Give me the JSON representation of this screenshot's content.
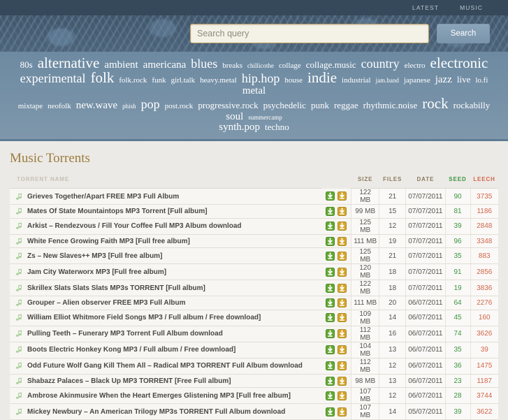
{
  "topnav": {
    "links": [
      {
        "label": "LATEST"
      },
      {
        "label": "MUSIC"
      }
    ]
  },
  "search": {
    "placeholder": "Search query",
    "value": "",
    "button_label": "Search"
  },
  "tagcloud": {
    "rows": [
      [
        {
          "label": "80s",
          "size": "s3"
        },
        {
          "label": "alternative",
          "size": "s6"
        },
        {
          "label": "ambient",
          "size": "s4"
        },
        {
          "label": "americana",
          "size": "s4"
        },
        {
          "label": "blues",
          "size": "s5"
        },
        {
          "label": "breaks",
          "size": "s2"
        },
        {
          "label": "chillicothe",
          "size": "s1"
        },
        {
          "label": "collage",
          "size": "s2"
        },
        {
          "label": "collage.music",
          "size": "s3"
        },
        {
          "label": "country",
          "size": "s5"
        },
        {
          "label": "electro",
          "size": "s2"
        },
        {
          "label": "electronic",
          "size": "s6"
        }
      ],
      [
        {
          "label": "experimental",
          "size": "s5"
        },
        {
          "label": "folk",
          "size": "s6"
        },
        {
          "label": "folk.rock",
          "size": "s2"
        },
        {
          "label": "funk",
          "size": "s2"
        },
        {
          "label": "girl.talk",
          "size": "s2"
        },
        {
          "label": "heavy.metal",
          "size": "s2"
        },
        {
          "label": "hip.hop",
          "size": "s5"
        },
        {
          "label": "house",
          "size": "s2"
        },
        {
          "label": "indie",
          "size": "s6"
        },
        {
          "label": "industrial",
          "size": "s2"
        },
        {
          "label": "jam.band",
          "size": "s1"
        },
        {
          "label": "japanese",
          "size": "s2"
        },
        {
          "label": "jazz",
          "size": "s4"
        },
        {
          "label": "live",
          "size": "s3"
        },
        {
          "label": "lo.fi",
          "size": "s2"
        },
        {
          "label": "metal",
          "size": "s4"
        }
      ],
      [
        {
          "label": "mixtape",
          "size": "s2"
        },
        {
          "label": "neofolk",
          "size": "s2"
        },
        {
          "label": "new.wave",
          "size": "s4"
        },
        {
          "label": "phish",
          "size": "s1"
        },
        {
          "label": "pop",
          "size": "s5"
        },
        {
          "label": "post.rock",
          "size": "s2"
        },
        {
          "label": "progressive.rock",
          "size": "s3"
        },
        {
          "label": "psychedelic",
          "size": "s3"
        },
        {
          "label": "punk",
          "size": "s3"
        },
        {
          "label": "reggae",
          "size": "s3"
        },
        {
          "label": "rhythmic.noise",
          "size": "s3"
        },
        {
          "label": "rock",
          "size": "s6"
        },
        {
          "label": "rockabilly",
          "size": "s3"
        },
        {
          "label": "soul",
          "size": "s4"
        },
        {
          "label": "summercamp",
          "size": "s1"
        }
      ],
      [
        {
          "label": "synth.pop",
          "size": "s4"
        },
        {
          "label": "techno",
          "size": "s3"
        }
      ]
    ]
  },
  "main": {
    "title": "Music Torrents",
    "columns": {
      "name": "TORRENT NAME",
      "download": "",
      "size": "SIZE",
      "files": "FILES",
      "date": "DATE",
      "seed": "SEED",
      "leech": "LEECH"
    },
    "colors": {
      "seed": "#3c9440",
      "leech": "#d2654a",
      "title": "#9c7c3f",
      "download_green": "#63a832",
      "download_gold": "#d3a52c"
    },
    "rows": [
      {
        "name": "Grieves Together/Apart FREE MP3 Full Album",
        "size": "122 MB",
        "files": "21",
        "date": "07/07/2011",
        "seed": "90",
        "leech": "3735"
      },
      {
        "name": "Mates Of State Mountaintops MP3 Torrent [Full album]",
        "size": "99 MB",
        "files": "15",
        "date": "07/07/2011",
        "seed": "81",
        "leech": "1186"
      },
      {
        "name": "Arkist – Rendezvous / Fill Your Coffee Full MP3 Album download",
        "size": "125 MB",
        "files": "12",
        "date": "07/07/2011",
        "seed": "39",
        "leech": "2848"
      },
      {
        "name": "White Fence Growing Faith MP3 [Full free album]",
        "size": "111 MB",
        "files": "19",
        "date": "07/07/2011",
        "seed": "96",
        "leech": "3348"
      },
      {
        "name": "Zs – New Slaves++ MP3 [Full free album]",
        "size": "125 MB",
        "files": "21",
        "date": "07/07/2011",
        "seed": "35",
        "leech": "883"
      },
      {
        "name": "Jam City Waterworx MP3 [Full free album]",
        "size": "120 MB",
        "files": "18",
        "date": "07/07/2011",
        "seed": "91",
        "leech": "2856"
      },
      {
        "name": "Skrillex Slats Slats Slats MP3s TORRENT [Full album]",
        "size": "122 MB",
        "files": "18",
        "date": "07/07/2011",
        "seed": "19",
        "leech": "3836"
      },
      {
        "name": "Grouper – Alien observer FREE MP3 Full Album",
        "size": "111 MB",
        "files": "20",
        "date": "06/07/2011",
        "seed": "64",
        "leech": "2276"
      },
      {
        "name": "William Elliot Whitmore Field Songs MP3 / Full album / Free download]",
        "size": "109 MB",
        "files": "14",
        "date": "06/07/2011",
        "seed": "45",
        "leech": "160"
      },
      {
        "name": "Pulling Teeth – Funerary MP3 Torrent Full Album download",
        "size": "112 MB",
        "files": "16",
        "date": "06/07/2011",
        "seed": "74",
        "leech": "3626"
      },
      {
        "name": "Boots Electric Honkey Kong MP3 / Full album / Free download]",
        "size": "104 MB",
        "files": "13",
        "date": "06/07/2011",
        "seed": "35",
        "leech": "39"
      },
      {
        "name": "Odd Future Wolf Gang Kill Them All – Radical MP3 TORRENT Full Album download",
        "size": "112 MB",
        "files": "12",
        "date": "06/07/2011",
        "seed": "36",
        "leech": "1475"
      },
      {
        "name": "Shabazz Palaces – Black Up MP3 TORRENT [Free Full album]",
        "size": "98 MB",
        "files": "13",
        "date": "06/07/2011",
        "seed": "23",
        "leech": "1187"
      },
      {
        "name": "Ambrose Akinmusire When the Heart Emerges Glistening MP3 [Full free album]",
        "size": "107 MB",
        "files": "12",
        "date": "06/07/2011",
        "seed": "28",
        "leech": "3744"
      },
      {
        "name": "Mickey Newbury – An American Trilogy MP3s TORRENT Full Album download",
        "size": "107 MB",
        "files": "14",
        "date": "05/07/2011",
        "seed": "39",
        "leech": "3622"
      }
    ]
  }
}
